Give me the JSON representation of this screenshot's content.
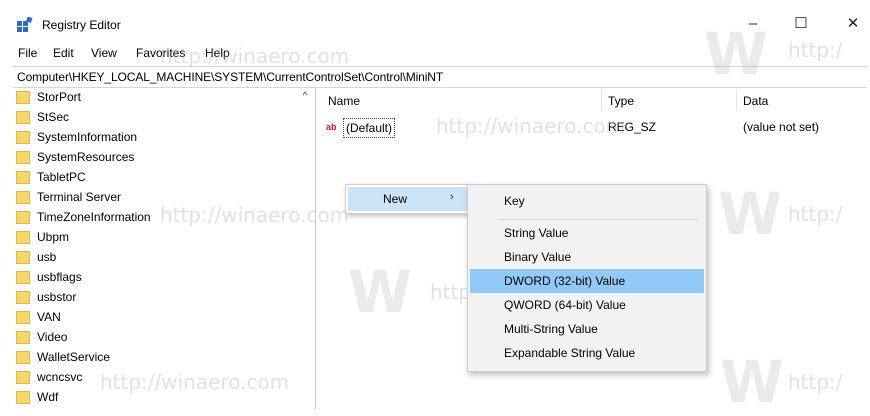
{
  "window": {
    "title": "Registry Editor",
    "controls": {
      "minimize": "–",
      "maximize": "☐",
      "close": "✕"
    }
  },
  "menu": [
    "File",
    "Edit",
    "View",
    "Favorites",
    "Help"
  ],
  "address": "Computer\\HKEY_LOCAL_MACHINE\\SYSTEM\\CurrentControlSet\\Control\\MiniNT",
  "tree": {
    "items": [
      "StorPort",
      "StSec",
      "SystemInformation",
      "SystemResources",
      "TabletPC",
      "Terminal Server",
      "TimeZoneInformation",
      "Ubpm",
      "usb",
      "usbflags",
      "usbstor",
      "VAN",
      "Video",
      "WalletService",
      "wcncsvc",
      "Wdf"
    ],
    "scroll_up": "^"
  },
  "values": {
    "columns": {
      "name": "Name",
      "type": "Type",
      "data": "Data"
    },
    "rows": [
      {
        "icon": "ab",
        "name": "(Default)",
        "type": "REG_SZ",
        "data": "(value not set)"
      }
    ]
  },
  "context_menu": {
    "new_label": "New",
    "arrow": "›",
    "submenu": [
      "Key",
      "String Value",
      "Binary Value",
      "DWORD (32-bit) Value",
      "QWORD (64-bit) Value",
      "Multi-String Value",
      "Expandable String Value"
    ],
    "active_index": 3
  },
  "watermark": {
    "text": "http://winaero.com",
    "short": "http:/",
    "letter": "W"
  },
  "colors": {
    "highlight": "#91c9f7",
    "menu_hover": "#cce4f7",
    "folder": "#f6d76a"
  }
}
